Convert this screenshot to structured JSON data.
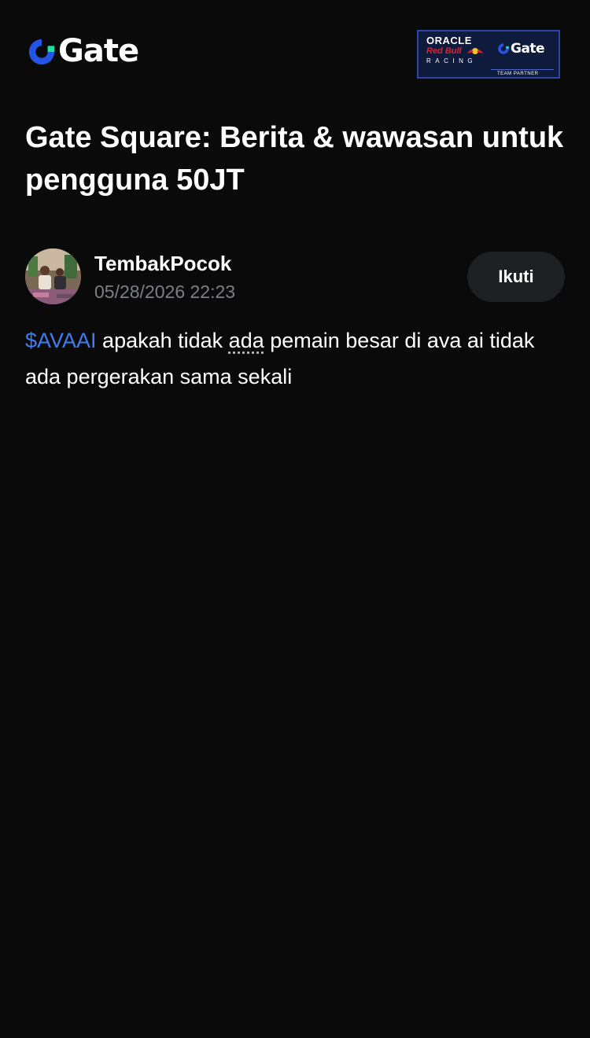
{
  "header": {
    "logo_text": "Gate",
    "logo_icon": "gate-logo-icon",
    "partner_badge": {
      "oracle": "ORACLE",
      "redbull": "Red Bull",
      "racing": "RACING",
      "gate": "Gate",
      "team": "TEAM PARTNER"
    }
  },
  "page_title": "Gate Square: Berita & wawasan untuk pengguna 50JT",
  "post": {
    "author": {
      "name": "TembakPocok",
      "timestamp": "05/28/2026 22:23",
      "avatar_icon": "user-avatar-photo"
    },
    "follow_label": "Ikuti",
    "body": {
      "ticker": "$AVAAI",
      "text_1": " apakah tidak ",
      "dotted_word": "ada",
      "text_2": " pemain besar di ava ai tidak ada pergerakan sama sekali"
    }
  },
  "colors": {
    "background": "#0a0a0b",
    "brand_blue": "#2354e6",
    "brand_green": "#17e5a0",
    "ticker_link": "#3f7df0",
    "muted_text": "#7d7f86",
    "button_bg": "#1f2023"
  }
}
